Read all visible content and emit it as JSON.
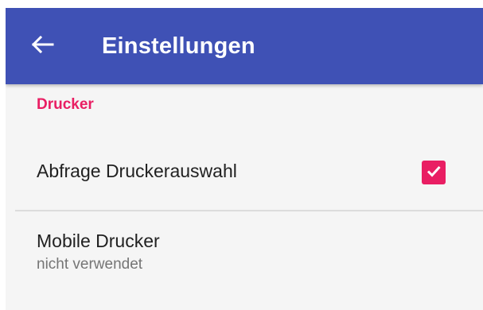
{
  "appbar": {
    "title": "Einstellungen",
    "back_icon": "arrow-left-icon",
    "color": "#3F51B5"
  },
  "category": {
    "label": "Drucker",
    "color": "#E91E63"
  },
  "preferences": [
    {
      "title": "Abfrage Druckerauswahl",
      "checked": true,
      "checkbox_icon": "checkbox-checked-icon"
    },
    {
      "title": "Mobile Drucker",
      "summary": "nicht verwendet"
    }
  ]
}
